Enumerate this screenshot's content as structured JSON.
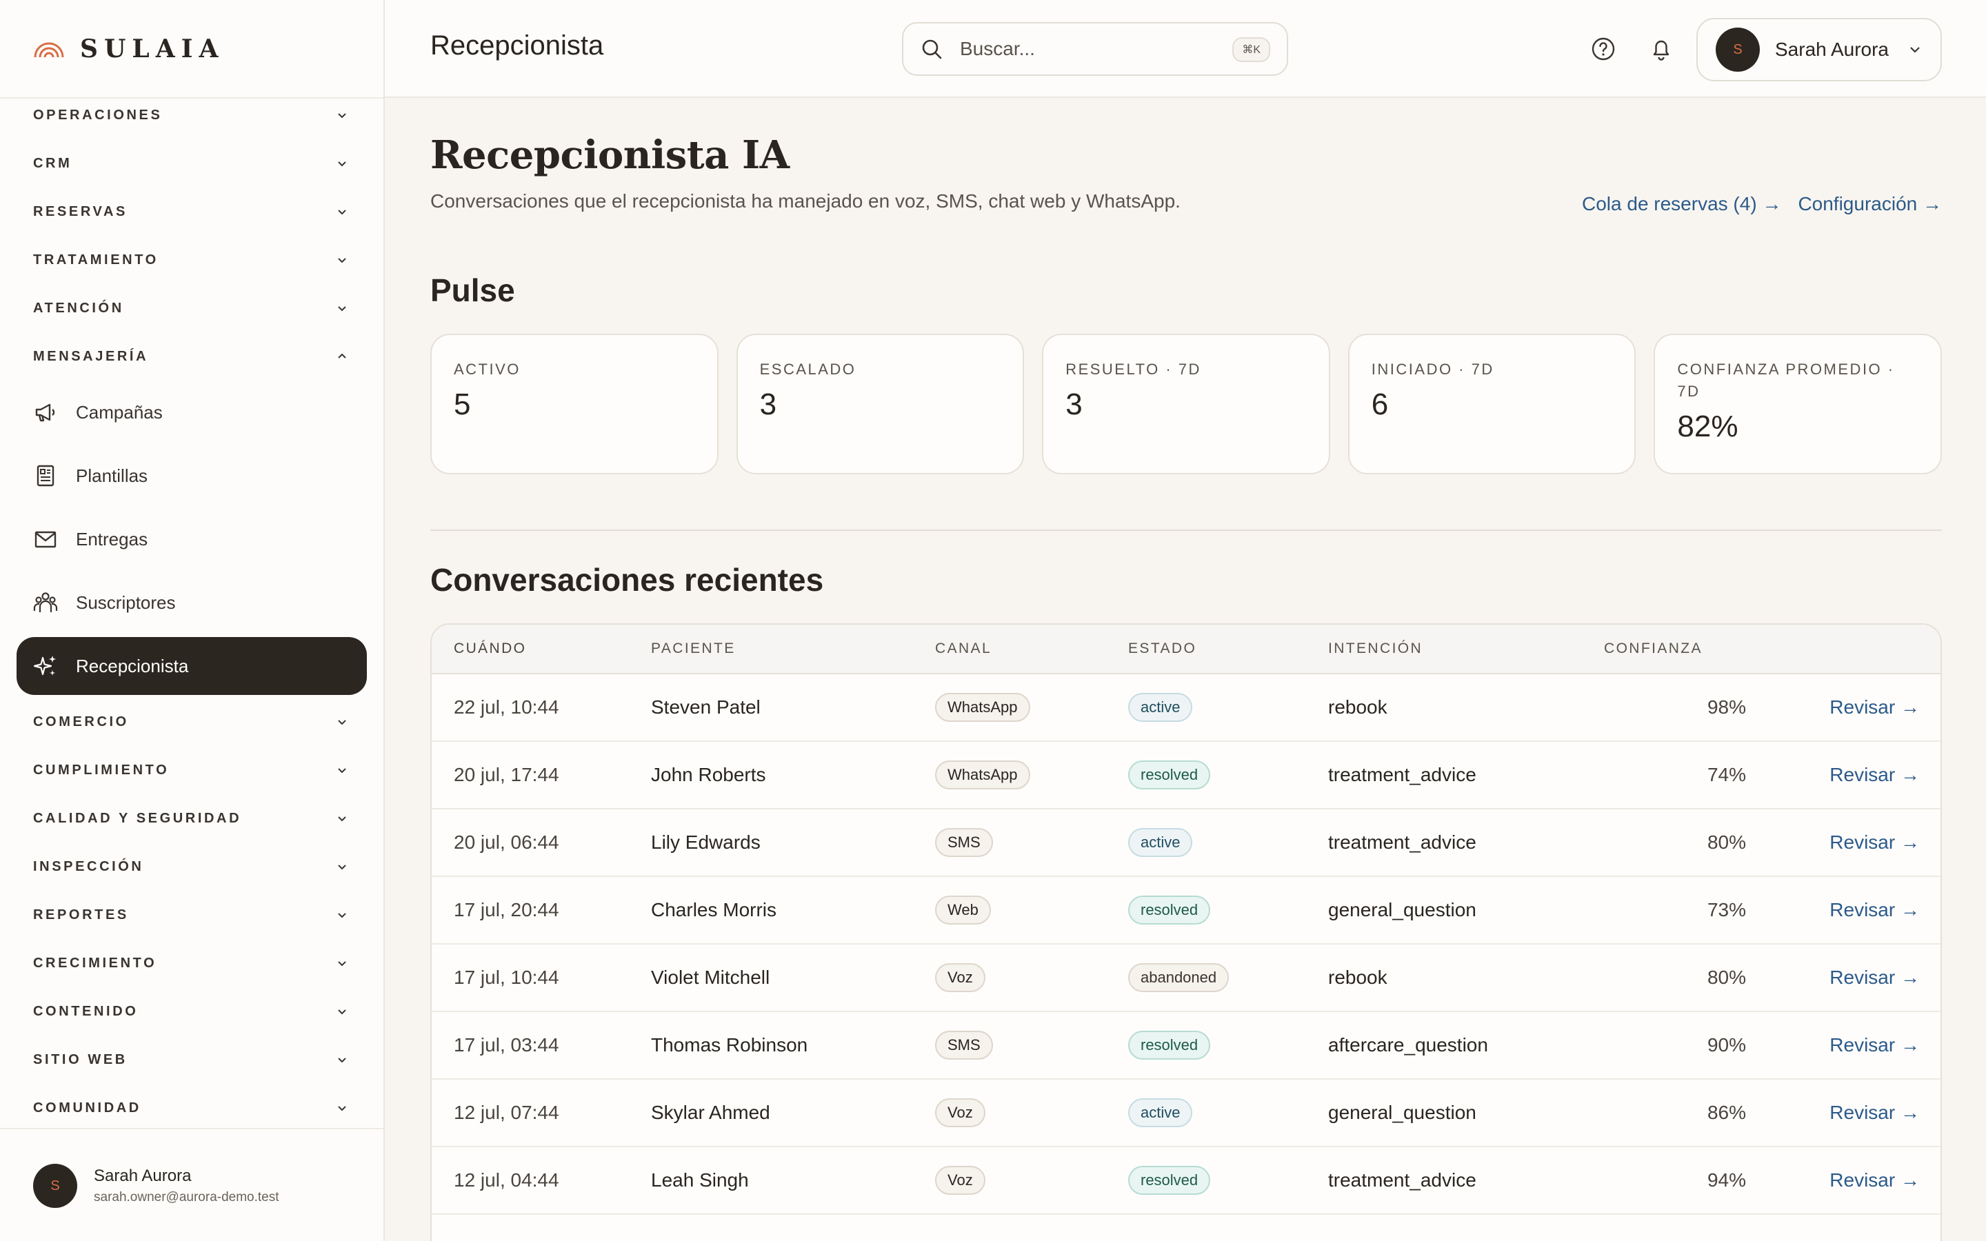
{
  "brand": {
    "name": "SULAIA"
  },
  "sidebar": {
    "sections_top": [
      {
        "label": "OPERACIONES"
      },
      {
        "label": "CRM"
      },
      {
        "label": "RESERVAS"
      },
      {
        "label": "TRATAMIENTO"
      },
      {
        "label": "ATENCIÓN"
      },
      {
        "label": "MENSAJERÍA"
      }
    ],
    "items": [
      {
        "label": "Campañas",
        "icon": "megaphone-icon"
      },
      {
        "label": "Plantillas",
        "icon": "template-icon"
      },
      {
        "label": "Entregas",
        "icon": "mail-icon"
      },
      {
        "label": "Suscriptores",
        "icon": "subscribers-icon"
      },
      {
        "label": "Recepcionista",
        "icon": "sparkles-icon"
      }
    ],
    "sections_bottom": [
      {
        "label": "COMERCIO"
      },
      {
        "label": "CUMPLIMIENTO"
      },
      {
        "label": "CALIDAD Y SEGURIDAD"
      },
      {
        "label": "INSPECCIÓN"
      },
      {
        "label": "REPORTES"
      },
      {
        "label": "CRECIMIENTO"
      },
      {
        "label": "CONTENIDO"
      },
      {
        "label": "SITIO WEB"
      },
      {
        "label": "COMUNIDAD"
      }
    ],
    "user": {
      "initial": "S",
      "name": "Sarah Aurora",
      "email": "sarah.owner@aurora-demo.test"
    }
  },
  "header": {
    "title": "Recepcionista",
    "search_placeholder": "Buscar...",
    "search_shortcut": "⌘K",
    "user": {
      "initial": "S",
      "name": "Sarah Aurora"
    }
  },
  "page": {
    "title": "Recepcionista IA",
    "subtitle": "Conversaciones que el recepcionista ha manejado en voz, SMS, chat web y WhatsApp.",
    "link_queue": "Cola de reservas (4) →",
    "link_config": "Configuración →"
  },
  "pulse": {
    "title": "Pulse",
    "cards": [
      {
        "label": "ACTIVO",
        "value": "5"
      },
      {
        "label": "ESCALADO",
        "value": "3"
      },
      {
        "label": "RESUELTO · 7D",
        "value": "3"
      },
      {
        "label": "INICIADO · 7D",
        "value": "6"
      },
      {
        "label": "CONFIANZA PROMEDIO · 7D",
        "value": "82%"
      }
    ]
  },
  "conversations": {
    "title": "Conversaciones recientes",
    "columns": {
      "when": "CUÁNDO",
      "patient": "PACIENTE",
      "channel": "CANAL",
      "state": "ESTADO",
      "intent": "INTENCIÓN",
      "confidence": "CONFIANZA"
    },
    "action_label": "Revisar →",
    "rows": [
      {
        "when": "22 jul, 10:44",
        "patient": "Steven Patel",
        "channel": "WhatsApp",
        "state": "active",
        "intent": "rebook",
        "confidence": "98%"
      },
      {
        "when": "20 jul, 17:44",
        "patient": "John Roberts",
        "channel": "WhatsApp",
        "state": "resolved",
        "intent": "treatment_advice",
        "confidence": "74%"
      },
      {
        "when": "20 jul, 06:44",
        "patient": "Lily Edwards",
        "channel": "SMS",
        "state": "active",
        "intent": "treatment_advice",
        "confidence": "80%"
      },
      {
        "when": "17 jul, 20:44",
        "patient": "Charles Morris",
        "channel": "Web",
        "state": "resolved",
        "intent": "general_question",
        "confidence": "73%"
      },
      {
        "when": "17 jul, 10:44",
        "patient": "Violet Mitchell",
        "channel": "Voz",
        "state": "abandoned",
        "intent": "rebook",
        "confidence": "80%"
      },
      {
        "when": "17 jul, 03:44",
        "patient": "Thomas Robinson",
        "channel": "SMS",
        "state": "resolved",
        "intent": "aftercare_question",
        "confidence": "90%"
      },
      {
        "when": "12 jul, 07:44",
        "patient": "Skylar Ahmed",
        "channel": "Voz",
        "state": "active",
        "intent": "general_question",
        "confidence": "86%"
      },
      {
        "when": "12 jul, 04:44",
        "patient": "Leah Singh",
        "channel": "Voz",
        "state": "resolved",
        "intent": "treatment_advice",
        "confidence": "94%"
      }
    ]
  },
  "colors": {
    "accent_dark": "#2c2621",
    "link": "#2c5a8a",
    "brand_orange": "#d86d46",
    "background": "#f8f5f0"
  }
}
